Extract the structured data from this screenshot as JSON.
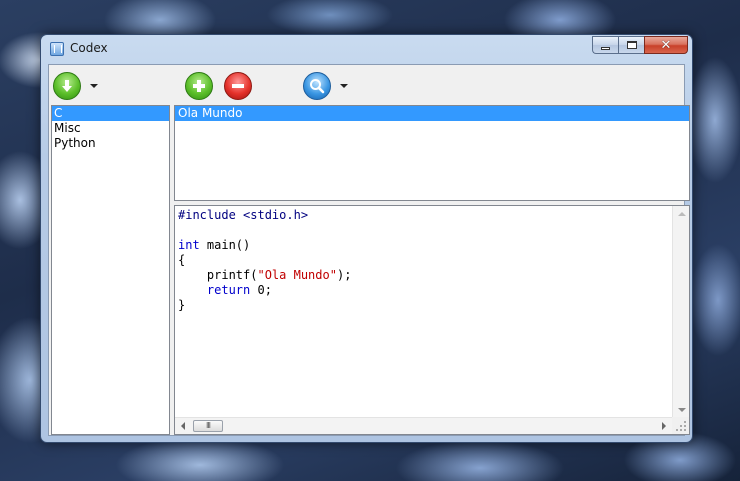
{
  "window": {
    "title": "Codex",
    "app_icon": "notebook-icon",
    "caption_buttons": [
      "minimize",
      "maximize",
      "close"
    ]
  },
  "toolbar": {
    "items": [
      {
        "name": "import-download-button",
        "icon": "green-down-arrow-icon",
        "has_dropdown": true
      },
      {
        "name": "add-button",
        "icon": "green-plus-icon",
        "has_dropdown": false
      },
      {
        "name": "remove-button",
        "icon": "red-minus-icon",
        "has_dropdown": false
      },
      {
        "name": "search-button",
        "icon": "magnifier-icon",
        "has_dropdown": true
      }
    ]
  },
  "categories": {
    "items": [
      "C",
      "Misc",
      "Python"
    ],
    "selected": "C"
  },
  "snippets": {
    "items": [
      "Ola Mundo"
    ],
    "selected": "Ola Mundo"
  },
  "editor": {
    "lines": [
      "#include <stdio.h>",
      "",
      "int main()",
      "{",
      "    printf(\"Ola Mundo\");",
      "    return 0;",
      "}"
    ],
    "hscroll_thumb_text": "III"
  },
  "colors": {
    "selection": "#3399ff",
    "keyword": "#0000cc",
    "string": "#c00000"
  }
}
